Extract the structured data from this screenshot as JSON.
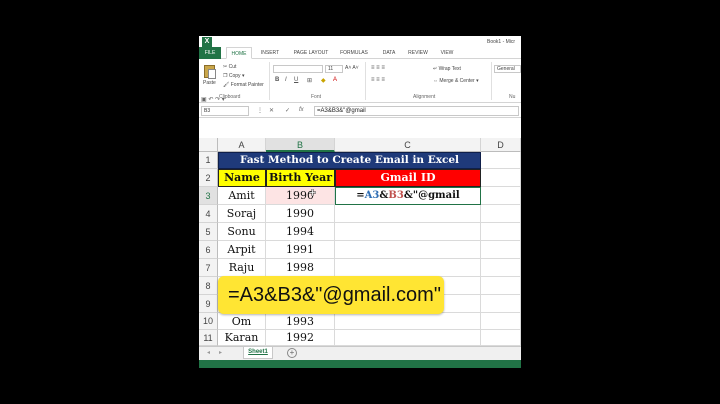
{
  "window": {
    "doc_title": "Book1 - Micr",
    "logo": "X"
  },
  "ribbon_tabs": [
    {
      "label": "FILE"
    },
    {
      "label": "HOME"
    },
    {
      "label": "INSERT"
    },
    {
      "label": "PAGE LAYOUT"
    },
    {
      "label": "FORMULAS"
    },
    {
      "label": "DATA"
    },
    {
      "label": "REVIEW"
    },
    {
      "label": "VIEW"
    }
  ],
  "ribbon": {
    "paste": "Paste",
    "cut": "Cut",
    "copy": "Copy",
    "format_painter": "Format Painter",
    "clipboard_label": "Clipboard",
    "font_size": "11",
    "bold": "B",
    "italic": "I",
    "underline": "U",
    "font_label": "Font",
    "wrap_text": "Wrap Text",
    "merge_center": "Merge & Center",
    "alignment_label": "Alignment",
    "number_format": "General",
    "number_label": "Nu"
  },
  "formula_bar": {
    "name_box": "B3",
    "fx": "fx",
    "cancel": "✕",
    "enter": "✓",
    "formula": "=A3&B3&\"@gmail"
  },
  "columns": [
    "A",
    "B",
    "C",
    "D"
  ],
  "rows": [
    "1",
    "2",
    "3",
    "4",
    "5",
    "6",
    "7",
    "8",
    "9",
    "10",
    "11"
  ],
  "sheet": {
    "title": "Fast Method to Create Email in Excel",
    "headers": {
      "name": "Name",
      "birth_year": "Birth Year",
      "gmail": "Gmail ID"
    },
    "data": [
      {
        "name": "Amit",
        "year": "1990"
      },
      {
        "name": "Soraj",
        "year": "1990"
      },
      {
        "name": "Sonu",
        "year": "1994"
      },
      {
        "name": "Arpit",
        "year": "1991"
      },
      {
        "name": "Raju",
        "year": "1998"
      },
      {
        "name": "",
        "year": ""
      },
      {
        "name": "",
        "year": ""
      },
      {
        "name": "Om",
        "year": "1993"
      },
      {
        "name": "Karan",
        "year": "1992"
      }
    ],
    "edit_cell": {
      "eq": "=",
      "ref_a": "A3",
      "amp1": "&",
      "ref_b": "B3",
      "rest": "&\"@gmail"
    }
  },
  "sheet_tabs": {
    "active": "Sheet1",
    "add": "+"
  },
  "callout": {
    "text": "=A3&B3&\"@gmail.com\""
  }
}
